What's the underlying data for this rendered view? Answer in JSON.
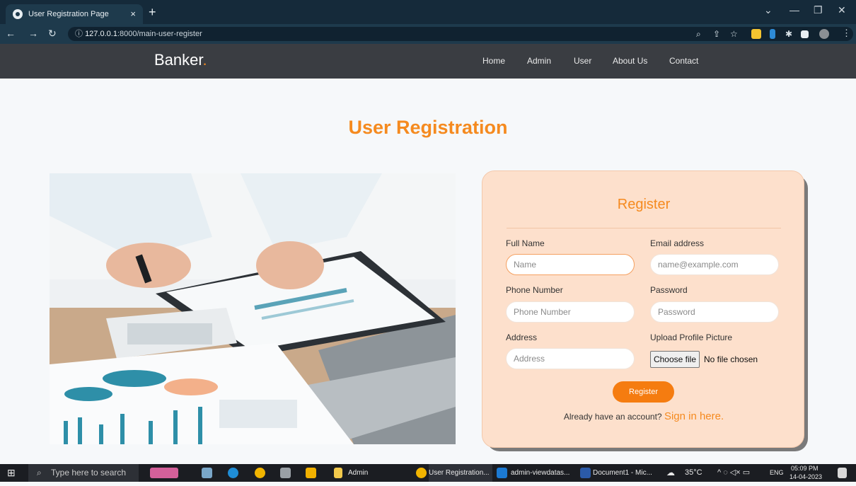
{
  "browser": {
    "tab_title": "User Registration Page",
    "tab_close": "×",
    "new_tab": "+",
    "url_host": "127.0.0.1",
    "url_rest": ":8000/main-user-register"
  },
  "site": {
    "brand": "Banker",
    "brand_dot": ".",
    "nav": [
      "Home",
      "Admin",
      "User",
      "About Us",
      "Contact"
    ]
  },
  "page": {
    "title": "User Registration"
  },
  "form": {
    "title": "Register",
    "full_name_label": "Full Name",
    "full_name_placeholder": "Name",
    "email_label": "Email address",
    "email_placeholder": "name@example.com",
    "phone_label": "Phone Number",
    "phone_placeholder": "Phone Number",
    "password_label": "Password",
    "password_placeholder": "Password",
    "address_label": "Address",
    "address_placeholder": "Address",
    "upload_label": "Upload Profile Picture",
    "choose_file": "Choose file",
    "no_file": "No file chosen",
    "register_button": "Register",
    "signin_prompt": "Already have an account?",
    "signin_link": "Sign in here."
  },
  "taskbar": {
    "search_placeholder": "Type here to search",
    "items": [
      "Admin",
      "User Registration...",
      "admin-viewdatas...",
      "Document1 - Mic..."
    ],
    "weather": "35°C",
    "lang": "ENG",
    "time": "05:09 PM",
    "date": "14-04-2023"
  },
  "colors": {
    "accent": "#f58a1f",
    "card_bg": "#fde0cc",
    "header_bg": "#3a3d42"
  }
}
